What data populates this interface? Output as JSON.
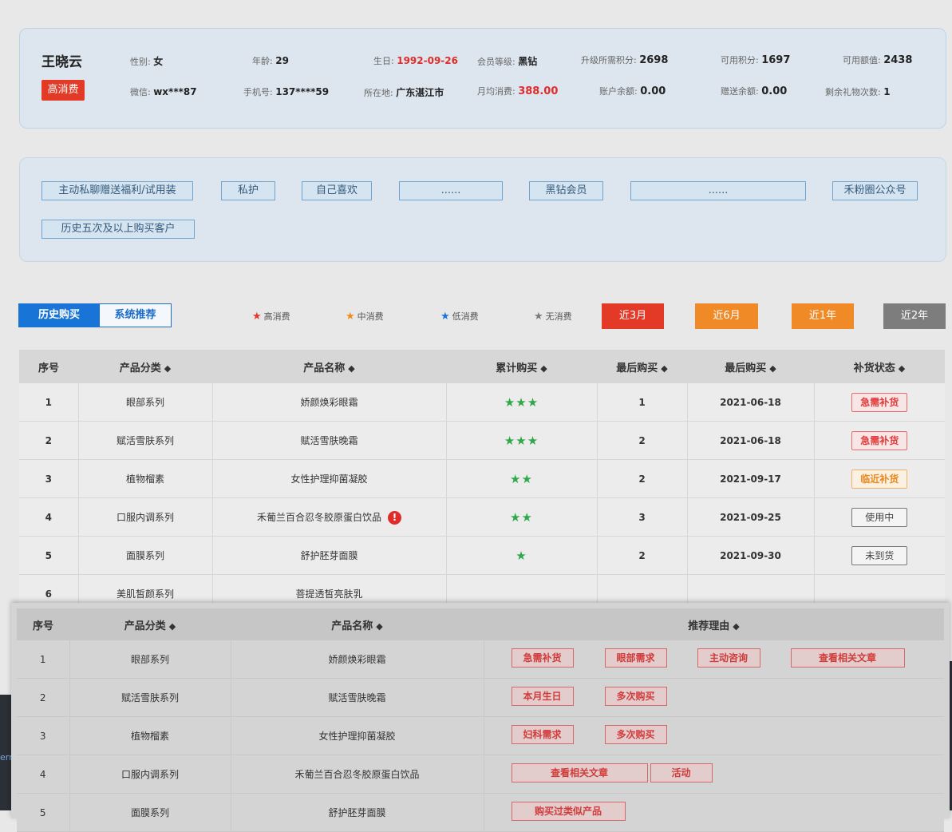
{
  "customer": {
    "name": "王晓云",
    "level_tag": "高消费",
    "gender": {
      "label": "性别:",
      "value": "女"
    },
    "age": {
      "label": "年龄:",
      "value": "29"
    },
    "birthday": {
      "label": "生日:",
      "value": "1992-09-26"
    },
    "member_level": {
      "label": "会员等级:",
      "value": "黑钻"
    },
    "upgrade_points": {
      "label": "升级所需积分:",
      "value": "2698"
    },
    "available_points": {
      "label": "可用积分:",
      "value": "1697"
    },
    "available_amount": {
      "label": "可用额值:",
      "value": "2438"
    },
    "wechat": {
      "label": "微信:",
      "value": "wx***87"
    },
    "phone": {
      "label": "手机号:",
      "value": "137****59"
    },
    "location": {
      "label": "所在地:",
      "value": "广东湛江市"
    },
    "monthly_spend": {
      "label": "月均消费:",
      "value": "388.00"
    },
    "balance": {
      "label": "账户余额:",
      "value": "0.00"
    },
    "gift_balance": {
      "label": "赠送余额:",
      "value": "0.00"
    },
    "gifts_left": {
      "label": "剩余礼物次数:",
      "value": "1"
    }
  },
  "tags": [
    "主动私聊赠送福利/试用装",
    "私护",
    "自己喜欢",
    "......",
    "黑钻会员",
    "......",
    "禾粉圈公众号",
    "历史五次及以上购买客户"
  ],
  "tabs": {
    "history": "历史购买",
    "recommend": "系统推荐"
  },
  "legend": [
    {
      "label": "高消费",
      "color": "#e0392b"
    },
    {
      "label": "中消费",
      "color": "#f08c1e"
    },
    {
      "label": "低消费",
      "color": "#1a73d8"
    },
    {
      "label": "无消费",
      "color": "#7a7a7a"
    }
  ],
  "ranges": [
    {
      "label": "近3月",
      "color": "#e23a26"
    },
    {
      "label": "近6月",
      "color": "#f08a26"
    },
    {
      "label": "近1年",
      "color": "#f08a26"
    },
    {
      "label": "近2年",
      "color": "#7d7d7d"
    }
  ],
  "history": {
    "headers": [
      "序号",
      "产品分类",
      "产品名称",
      "累计购买",
      "最后购买",
      "最后购买",
      "补货状态"
    ],
    "rows": [
      {
        "no": "1",
        "category": "眼部系列",
        "name": "娇颜焕彩眼霜",
        "stars": "★★★",
        "count": "1",
        "date": "2021-06-18",
        "status": "急需补货",
        "status_type": "urgent"
      },
      {
        "no": "2",
        "category": "赋活雪肤系列",
        "name": "赋活雪肤晚霜",
        "stars": "★★★",
        "count": "2",
        "date": "2021-06-18",
        "status": "急需补货",
        "status_type": "urgent"
      },
      {
        "no": "3",
        "category": "植物榴素",
        "name": "女性护理抑菌凝胶",
        "stars": "★★",
        "count": "2",
        "date": "2021-09-17",
        "status": "临近补货",
        "status_type": "near"
      },
      {
        "no": "4",
        "category": "口服内调系列",
        "name": "禾葡兰百合忍冬胶原蛋白饮品",
        "stars": "★★",
        "count": "3",
        "date": "2021-09-25",
        "status": "使用中",
        "status_type": "using"
      },
      {
        "no": "5",
        "category": "面膜系列",
        "name": "舒护胚芽面膜",
        "stars": "★",
        "count": "2",
        "date": "2021-09-30",
        "status": "未到货",
        "status_type": "na"
      },
      {
        "no": "6",
        "category": "美肌皙颜系列",
        "name": "菩提透皙亮肤乳",
        "stars": "",
        "count": "",
        "date": "",
        "status": "",
        "status_type": ""
      }
    ]
  },
  "recommend": {
    "headers": [
      "序号",
      "产品分类",
      "产品名称",
      "推荐理由"
    ],
    "rows": [
      {
        "no": "1",
        "category": "眼部系列",
        "name": "娇颜焕彩眼霜",
        "reasons": [
          "急需补货",
          "眼部需求",
          "主动咨询",
          "查看相关文章"
        ]
      },
      {
        "no": "2",
        "category": "赋活雪肤系列",
        "name": "赋活雪肤晚霜",
        "reasons": [
          "本月生日",
          "多次购买"
        ]
      },
      {
        "no": "3",
        "category": "植物榴素",
        "name": "女性护理抑菌凝胶",
        "reasons": [
          "妇科需求",
          "多次购买"
        ]
      },
      {
        "no": "4",
        "category": "口服内调系列",
        "name": "禾葡兰百合忍冬胶原蛋白饮品",
        "reasons": [
          "查看相关文章",
          "活动"
        ]
      },
      {
        "no": "5",
        "category": "面膜系列",
        "name": "舒护胚芽面膜",
        "reasons": [
          "购买过类似产品"
        ]
      }
    ]
  },
  "background_text": "ern"
}
